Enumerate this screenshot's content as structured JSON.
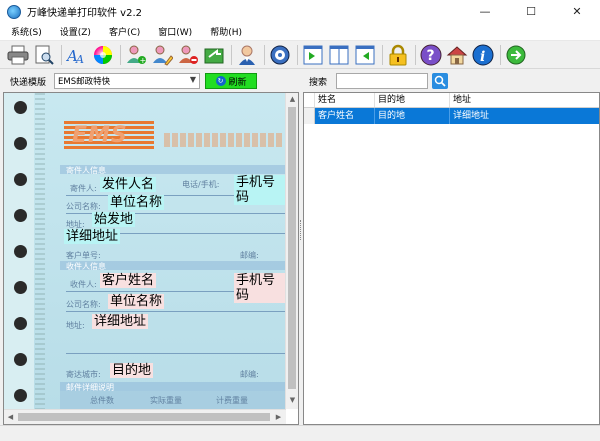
{
  "window": {
    "title": "万峰快递单打印软件 v2.2",
    "controls": {
      "minimize": "—",
      "maximize": "☐",
      "close": "✕"
    }
  },
  "menu": [
    "系统(S)",
    "设置(Z)",
    "客户(C)",
    "窗口(W)",
    "帮助(H)"
  ],
  "toolbar_icons": [
    "printer-icon",
    "print-preview-icon",
    "font-icon",
    "color-wheel-icon",
    "add-user-icon",
    "edit-user-icon",
    "delete-user-icon",
    "export-icon",
    "user-icon",
    "settings-disk-icon",
    "panel-left-icon",
    "panel-center-icon",
    "panel-right-icon",
    "lock-icon",
    "help-icon",
    "home-icon",
    "info-icon",
    "exit-arrow-icon"
  ],
  "left": {
    "template_label": "快递模版",
    "template_value": "EMS邮政特快",
    "refresh_label": "刷新"
  },
  "waybill": {
    "logo": "EMS",
    "sender_section": "寄件人信息",
    "recipient_section": "收件人信息",
    "detail_section": "邮件详细说明",
    "labels": {
      "sender": "寄件人:",
      "phone": "电话/手机:",
      "company": "公司名称:",
      "address": "地址:",
      "customer_no": "客户单号:",
      "postcode": "邮编:",
      "recipient": "收件人:",
      "company2": "公司名称:",
      "address2": "地址:",
      "dest_city": "寄达城市:",
      "postcode2": "邮编:",
      "pieces": "总件数",
      "actual_weight": "实际重量",
      "charged_weight": "计费重量"
    },
    "fields": {
      "sender_name": "发件人名",
      "sender_phone": "手机号码",
      "sender_company": "单位名称",
      "origin": "始发地",
      "sender_address": "详细地址",
      "recipient_name": "客户姓名",
      "recipient_phone": "手机号码",
      "recipient_company": "单位名称",
      "recipient_address": "详细地址",
      "destination": "目的地"
    }
  },
  "right": {
    "search_label": "搜索",
    "search_value": "",
    "columns": [
      "",
      "姓名",
      "目的地",
      "地址"
    ],
    "rows": [
      {
        "indicator": "",
        "name": "客户姓名",
        "destination": "目的地",
        "address": "详细地址"
      }
    ]
  },
  "colors": {
    "selection": "#0a78d7",
    "refresh_button": "#22dd22",
    "field_cyan": "#b8f4f4",
    "field_pink": "#f8e0e0"
  }
}
